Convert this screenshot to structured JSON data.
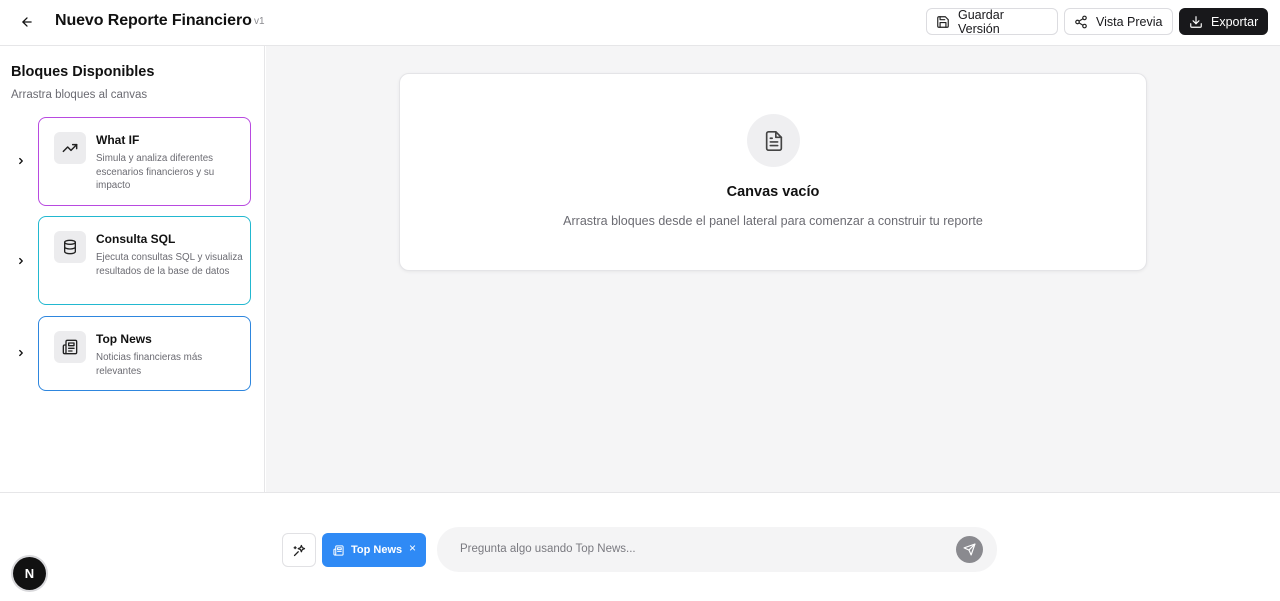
{
  "header": {
    "title": "Nuevo Reporte Financiero",
    "version": "v1",
    "save_label": "Guardar Versión",
    "preview_label": "Vista Previa",
    "export_label": "Exportar"
  },
  "sidebar": {
    "title": "Bloques Disponibles",
    "subtitle": "Arrastra bloques al canvas",
    "blocks": [
      {
        "title": "What IF",
        "description": "Simula y analiza diferentes escenarios financieros y su impacto",
        "icon": "trending-up-icon",
        "border_color": "#b84ae0"
      },
      {
        "title": "Consulta SQL",
        "description": "Ejecuta consultas SQL y visualiza resultados de la base de datos",
        "icon": "database-icon",
        "border_color": "#22b8d0"
      },
      {
        "title": "Top News",
        "description": "Noticias financieras más relevantes",
        "icon": "newspaper-icon",
        "border_color": "#2e86de"
      }
    ]
  },
  "canvas": {
    "empty_title": "Canvas vacío",
    "empty_text": "Arrastra bloques desde el panel lateral para comenzar a construir tu reporte"
  },
  "chat": {
    "chip_label": "Top News",
    "chip_close": "×",
    "placeholder": "Pregunta algo usando Top News...",
    "value": ""
  },
  "badge": {
    "label": "N"
  },
  "colors": {
    "primary": "#18181b",
    "chip": "#2f8af5",
    "canvas_bg": "#f5f5f6"
  }
}
